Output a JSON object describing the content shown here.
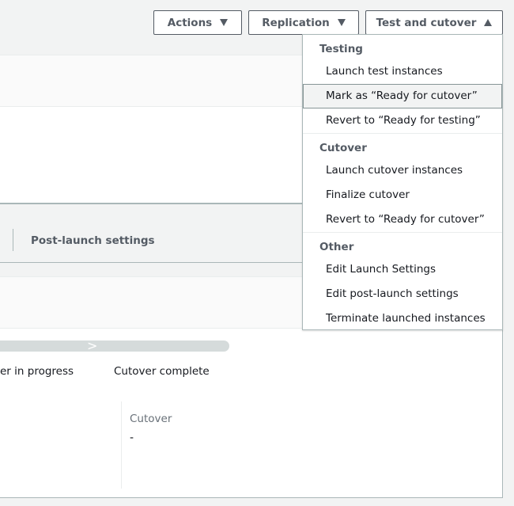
{
  "header": {
    "actions_label": "Actions",
    "replication_label": "Replication",
    "test_cutover_label": "Test and cutover"
  },
  "tabs": {
    "post_launch": "Post-launch settings"
  },
  "lifecycle": {
    "steps": [
      "er in progress",
      "Cutover complete"
    ]
  },
  "details": {
    "cutover_label": "Cutover",
    "cutover_value": "-"
  },
  "menu": {
    "groups": [
      {
        "label": "Testing",
        "items": [
          "Launch test instances",
          "Mark as “Ready for cutover”",
          "Revert to “Ready for testing”"
        ]
      },
      {
        "label": "Cutover",
        "items": [
          "Launch cutover instances",
          "Finalize cutover",
          "Revert to “Ready for cutover”"
        ]
      },
      {
        "label": "Other",
        "items": [
          "Edit Launch Settings",
          "Edit post-launch settings",
          "Terminate launched instances"
        ]
      }
    ]
  }
}
